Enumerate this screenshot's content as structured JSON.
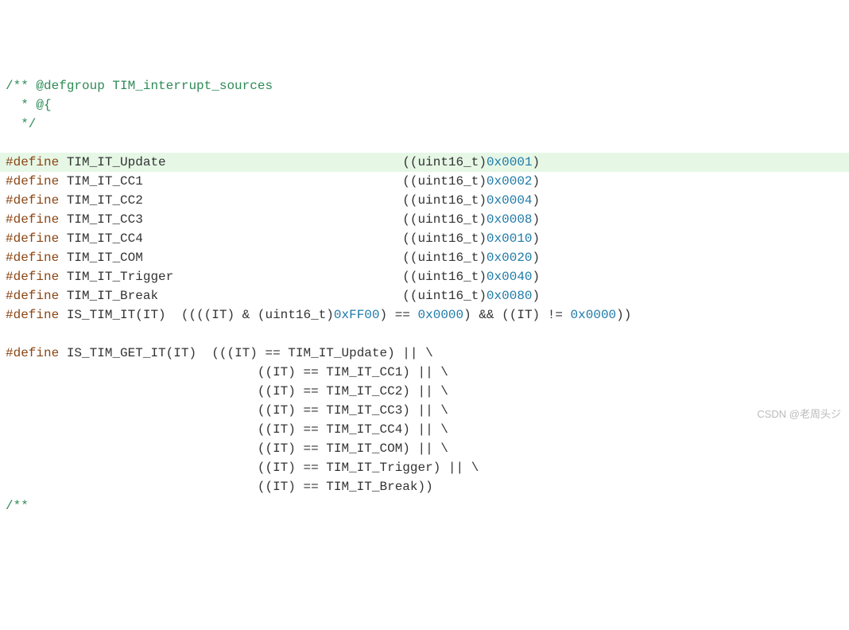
{
  "comment": {
    "l1_a": "/** ",
    "l1_b": "@defgroup",
    "l1_c": " TIM_interrupt_sources",
    "l2": "  * @{",
    "l3": "  */"
  },
  "defines": [
    {
      "keyword": "#define",
      "name": "TIM_IT_Update",
      "cast": "((uint16_t)",
      "value": "0x0001",
      "close": ")"
    },
    {
      "keyword": "#define",
      "name": "TIM_IT_CC1",
      "cast": "((uint16_t)",
      "value": "0x0002",
      "close": ")"
    },
    {
      "keyword": "#define",
      "name": "TIM_IT_CC2",
      "cast": "((uint16_t)",
      "value": "0x0004",
      "close": ")"
    },
    {
      "keyword": "#define",
      "name": "TIM_IT_CC3",
      "cast": "((uint16_t)",
      "value": "0x0008",
      "close": ")"
    },
    {
      "keyword": "#define",
      "name": "TIM_IT_CC4",
      "cast": "((uint16_t)",
      "value": "0x0010",
      "close": ")"
    },
    {
      "keyword": "#define",
      "name": "TIM_IT_COM",
      "cast": "((uint16_t)",
      "value": "0x0020",
      "close": ")"
    },
    {
      "keyword": "#define",
      "name": "TIM_IT_Trigger",
      "cast": "((uint16_t)",
      "value": "0x0040",
      "close": ")"
    },
    {
      "keyword": "#define",
      "name": "TIM_IT_Break",
      "cast": "((uint16_t)",
      "value": "0x0080",
      "close": ")"
    }
  ],
  "is_tim_it": {
    "keyword": "#define",
    "name": "IS_TIM_IT(IT)",
    "p1": "((((IT) & (uint16_t)",
    "v1": "0xFF00",
    "p2": ") == ",
    "v2": "0x0000",
    "p3": ") && ((IT) != ",
    "v3": "0x0000",
    "p4": "))"
  },
  "get_it": {
    "keyword": "#define",
    "name": "IS_TIM_GET_IT(IT)",
    "l1": "(((IT) == TIM_IT_Update) || \\",
    "l2": "((IT) == TIM_IT_CC1) || \\",
    "l3": "((IT) == TIM_IT_CC2) || \\",
    "l4": "((IT) == TIM_IT_CC3) || \\",
    "l5": "((IT) == TIM_IT_CC4) || \\",
    "l6": "((IT) == TIM_IT_COM) || \\",
    "l7": "((IT) == TIM_IT_Trigger) || \\",
    "l8": "((IT) == TIM_IT_Break))"
  },
  "tail": "/**",
  "watermark": "CSDN @老周头ジ",
  "highlight_index": 0
}
